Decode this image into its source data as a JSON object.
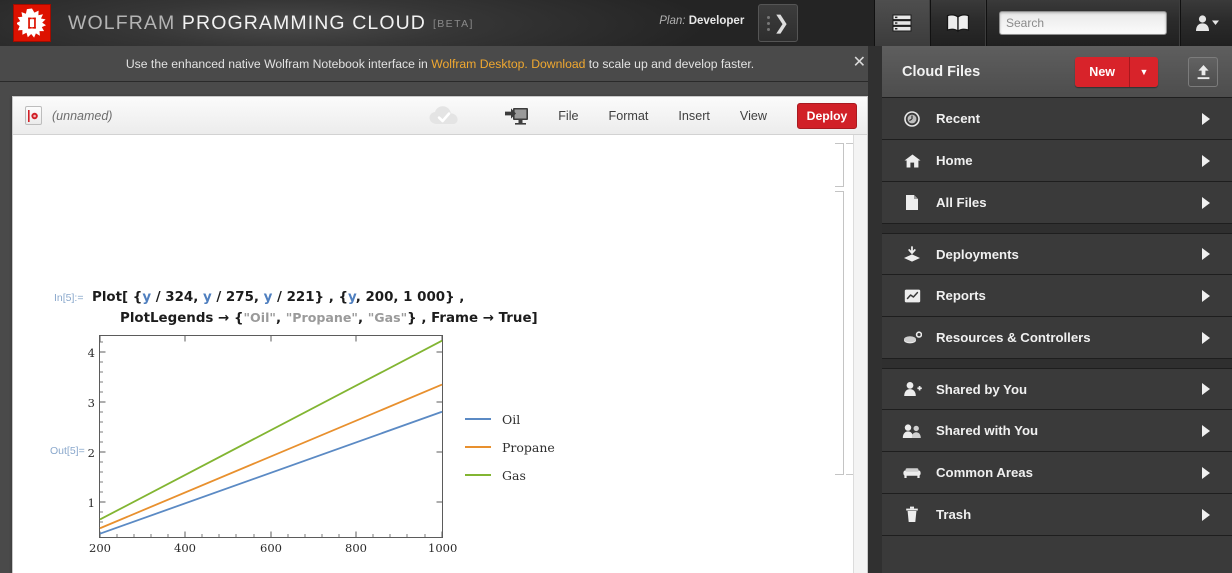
{
  "header": {
    "brand_prefix": "WOLFRAM",
    "brand_suffix": "PROGRAMMING CLOUD",
    "beta_tag": "[BETA]",
    "plan_label": "Plan:",
    "plan_value": "Developer",
    "expand_icon": "chevron-right-icon",
    "grid_icon": "cell-grid-icon",
    "book_icon": "documentation-book-icon",
    "user_icon": "user-account-icon",
    "search": {
      "value": "",
      "placeholder": "Search",
      "icon": "search-icon"
    }
  },
  "notice": {
    "text_before": "Use the enhanced native Wolfram Notebook interface in ",
    "link1": "Wolfram Desktop.",
    "link2": " Download",
    "text_after": " to scale up and develop faster.",
    "close_icon": "close-icon",
    "bg": "#4a4a4a",
    "link_color": "#f0a830"
  },
  "notebook": {
    "tab_icon": "wolfram-notebook-icon",
    "title": "(unnamed)",
    "cloud_status_icon": "cloud-saved-icon",
    "deploy_screen_icon": "deploy-to-screen-icon",
    "menus": [
      "File",
      "Format",
      "Insert",
      "View"
    ],
    "deploy_button": "Deploy",
    "in_label": "In[5]:=",
    "out_label": "Out[5]=",
    "code_line1": [
      {
        "t": "Plot[ {",
        "c": "plain"
      },
      {
        "t": "y",
        "c": "var"
      },
      {
        "t": " / 324, ",
        "c": "plain"
      },
      {
        "t": "y",
        "c": "var"
      },
      {
        "t": " / 275, ",
        "c": "plain"
      },
      {
        "t": "y",
        "c": "var"
      },
      {
        "t": " / 221} , {",
        "c": "plain"
      },
      {
        "t": "y",
        "c": "var"
      },
      {
        "t": ", 200, 1 000} ,",
        "c": "plain"
      }
    ],
    "code_line2": [
      {
        "t": "PlotLegends ",
        "c": "plain"
      },
      {
        "t": "→",
        "c": "plain"
      },
      {
        "t": " {",
        "c": "plain"
      },
      {
        "t": "\"Oil\"",
        "c": "str"
      },
      {
        "t": ", ",
        "c": "plain"
      },
      {
        "t": "\"Propane\"",
        "c": "str"
      },
      {
        "t": ", ",
        "c": "plain"
      },
      {
        "t": "\"Gas\"",
        "c": "str"
      },
      {
        "t": "} , Frame ",
        "c": "plain"
      },
      {
        "t": "→",
        "c": "plain"
      },
      {
        "t": " True]",
        "c": "plain"
      }
    ]
  },
  "chart_data": {
    "type": "line",
    "title": "",
    "xlabel": "",
    "ylabel": "",
    "xlim": [
      200,
      1000
    ],
    "ylim": [
      0.55,
      4.62
    ],
    "xticks": [
      200,
      400,
      600,
      800,
      1000
    ],
    "yticks": [
      1,
      2,
      3,
      4
    ],
    "grid": false,
    "frame": true,
    "legend_position": "right",
    "x": [
      200,
      1000
    ],
    "series": [
      {
        "name": "Oil",
        "color": "#5b8ac4",
        "expression": "y/324",
        "values": [
          0.617,
          3.086
        ]
      },
      {
        "name": "Propane",
        "color": "#e8902e",
        "expression": "y/275",
        "values": [
          0.727,
          3.636
        ]
      },
      {
        "name": "Gas",
        "color": "#82b532",
        "expression": "y/221",
        "values": [
          0.905,
          4.525
        ]
      }
    ]
  },
  "panel": {
    "title": "Cloud Files",
    "new_button": "New",
    "new_dropdown_icon": "chevron-down-icon",
    "upload_icon": "upload-icon",
    "accent_red": "#d8232a",
    "items": [
      {
        "label": "Recent",
        "icon": "recent-clock-icon",
        "group": 0
      },
      {
        "label": "Home",
        "icon": "home-icon",
        "group": 0
      },
      {
        "label": "All Files",
        "icon": "file-document-icon",
        "group": 0
      },
      {
        "label": "Deployments",
        "icon": "deployments-layers-icon",
        "group": 1
      },
      {
        "label": "Reports",
        "icon": "reports-chart-icon",
        "group": 1
      },
      {
        "label": "Resources & Controllers",
        "icon": "resources-icon",
        "group": 1
      },
      {
        "label": "Shared by You",
        "icon": "user-plus-icon",
        "group": 2
      },
      {
        "label": "Shared with You",
        "icon": "users-group-icon",
        "group": 2
      },
      {
        "label": "Common Areas",
        "icon": "sofa-icon",
        "group": 2
      },
      {
        "label": "Trash",
        "icon": "trash-icon",
        "group": 2
      }
    ]
  }
}
